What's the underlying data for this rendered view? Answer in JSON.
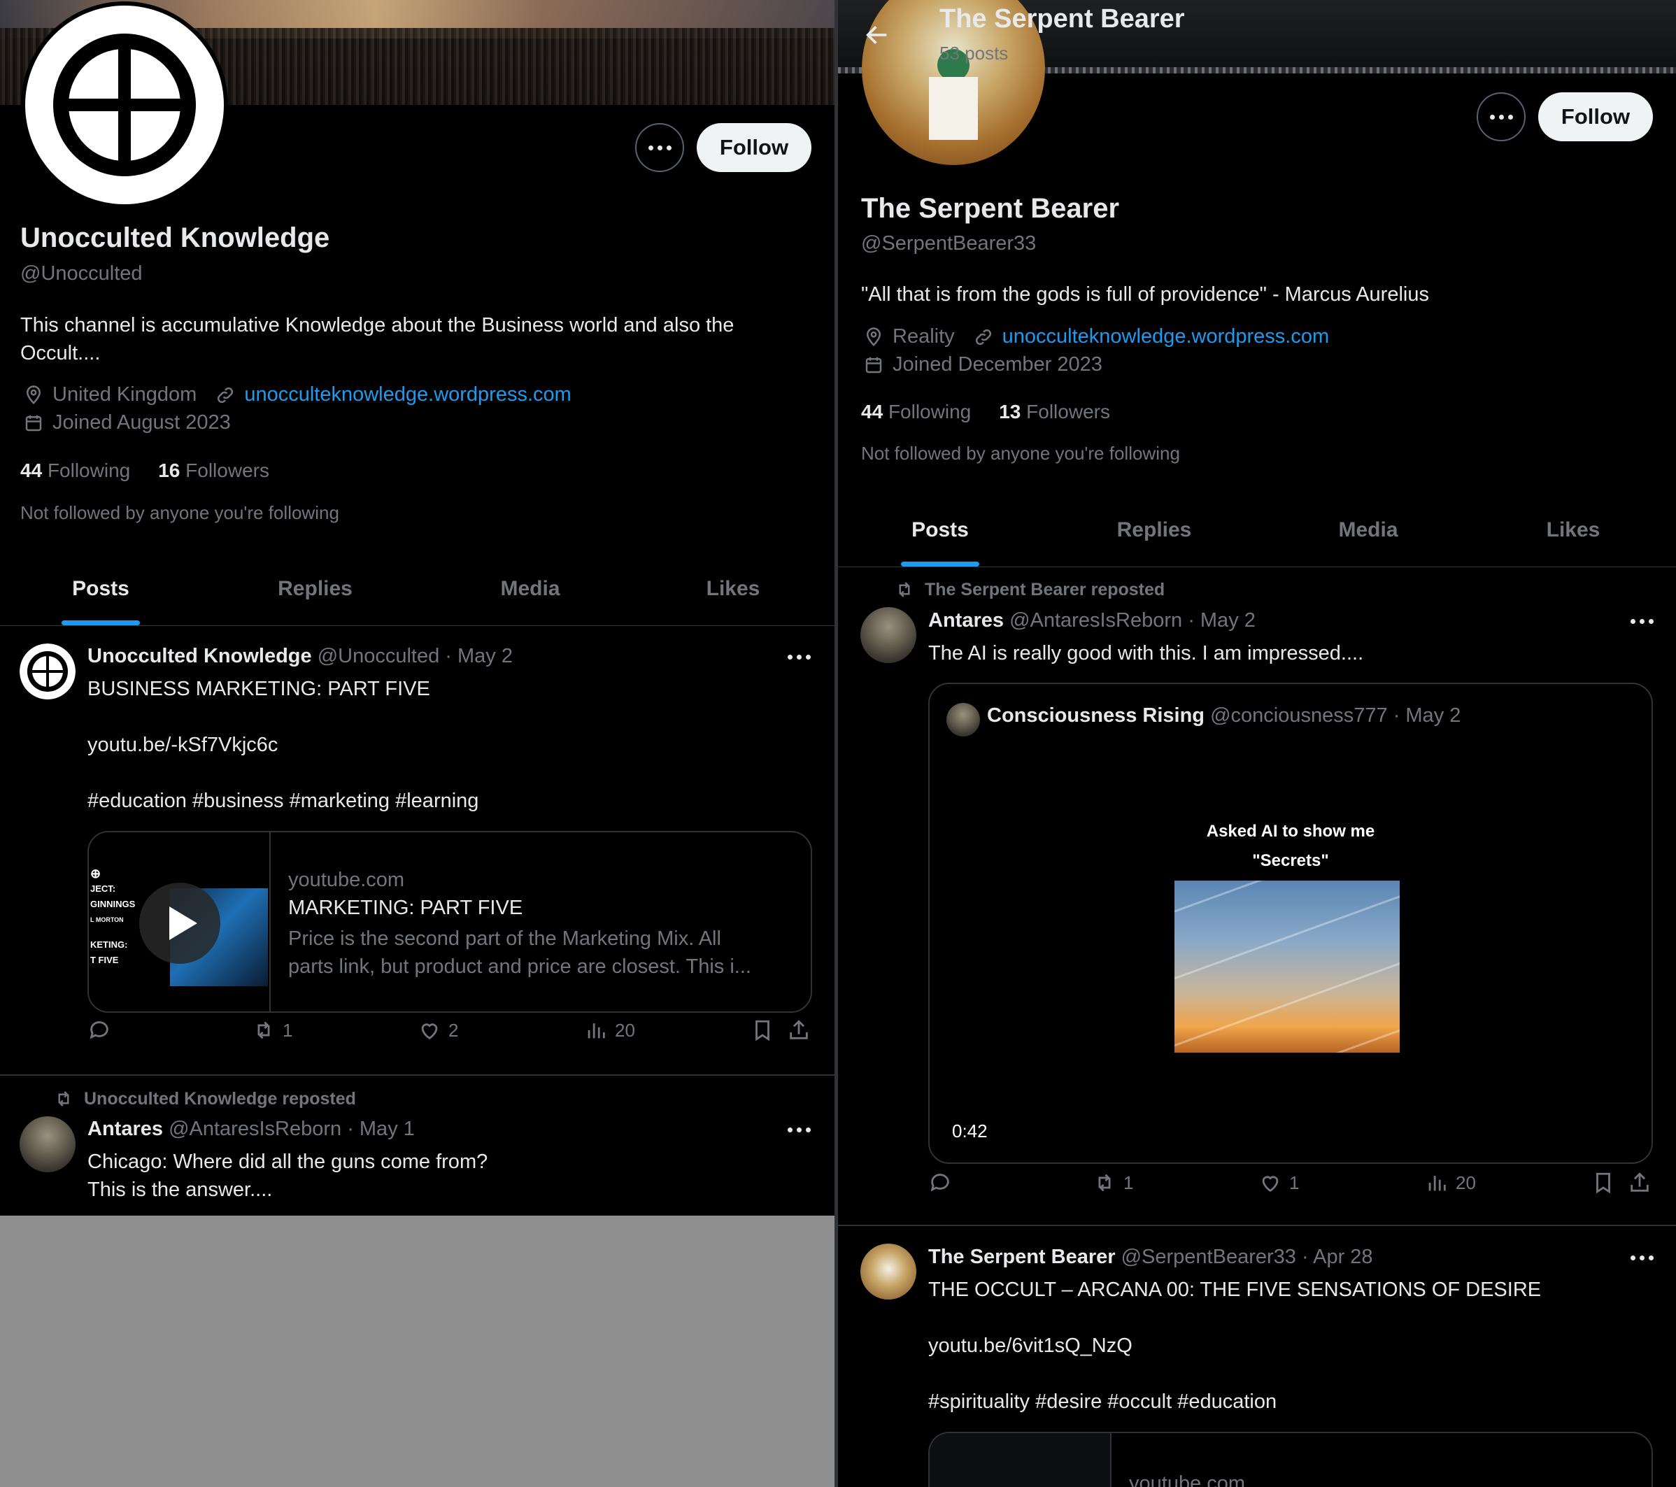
{
  "left": {
    "profile": {
      "name": "Unocculted Knowledge",
      "handle": "@Unocculted",
      "bio": "This channel is accumulative Knowledge about the Business world and also the Occult....",
      "location": "United Kingdom",
      "website": "unocculteknowledge.wordpress.com",
      "joined": "Joined August 2023",
      "following_count": "44",
      "following_label": "Following",
      "followers_count": "16",
      "followers_label": "Followers",
      "not_followed": "Not followed by anyone you're following",
      "follow_label": "Follow"
    },
    "tabs": [
      "Posts",
      "Replies",
      "Media",
      "Likes"
    ],
    "post1": {
      "name": "Unocculted Knowledge",
      "handle": "@Unocculted",
      "date": "· May 2",
      "text": "BUSINESS MARKETING: PART FIVE",
      "link": "youtu.be/-kSf7Vkjc6c",
      "hashtags": "#education #business #marketing #learning",
      "card": {
        "domain": "youtube.com",
        "title": "MARKETING: PART FIVE",
        "desc_line1": "Price is the second part of the Marketing Mix. All",
        "desc_line2": "parts link, but product and price are closest. This i...",
        "thumb_lines": [
          "JECT:",
          "GINNINGS",
          "L MORTON",
          "KETING:",
          "T FIVE"
        ]
      },
      "stats": {
        "retweets": "1",
        "likes": "2",
        "views": "20"
      }
    },
    "post2": {
      "repost_label": "Unocculted Knowledge reposted",
      "name": "Antares",
      "handle": "@AntaresIsReborn",
      "date": "· May 1",
      "text_line1": "Chicago: Where did all the guns come from?",
      "text_line2": "This is the answer...."
    }
  },
  "right": {
    "header": {
      "title": "The Serpent Bearer",
      "subtitle": "53 posts"
    },
    "profile": {
      "name": "The Serpent Bearer",
      "handle": "@SerpentBearer33",
      "bio": "\"All that is from the gods is full of providence\" - Marcus Aurelius",
      "location": "Reality",
      "website": "unocculteknowledge.wordpress.com",
      "joined": "Joined December 2023",
      "following_count": "44",
      "following_label": "Following",
      "followers_count": "13",
      "followers_label": "Followers",
      "not_followed": "Not followed by anyone you're following",
      "follow_label": "Follow"
    },
    "tabs": [
      "Posts",
      "Replies",
      "Media",
      "Likes"
    ],
    "post1": {
      "repost_label": "The Serpent Bearer reposted",
      "name": "Antares",
      "handle": "@AntaresIsReborn",
      "date": "· May 2",
      "text": "The AI is really good with this. I am impressed....",
      "quote": {
        "name": "Consciousness Rising",
        "handle": "@conciousness777",
        "date": "· May 2",
        "video_caption_line1": "Asked AI to show me",
        "video_caption_line2": "\"Secrets\"",
        "duration": "0:42"
      },
      "stats": {
        "retweets": "1",
        "likes": "1",
        "views": "20"
      }
    },
    "post2": {
      "name": "The Serpent Bearer",
      "handle": "@SerpentBearer33",
      "date": "· Apr 28",
      "text": "THE OCCULT – ARCANA 00: THE FIVE SENSATIONS OF DESIRE",
      "link": "youtu.be/6vit1sQ_NzQ",
      "hashtags": "#spirituality #desire #occult #education",
      "card_domain": "youtube.com"
    }
  },
  "colors": {
    "accent": "#1d9bf0",
    "background": "#000000",
    "text": "#e7e9ea",
    "muted": "#71767b",
    "border": "#2f3336"
  }
}
